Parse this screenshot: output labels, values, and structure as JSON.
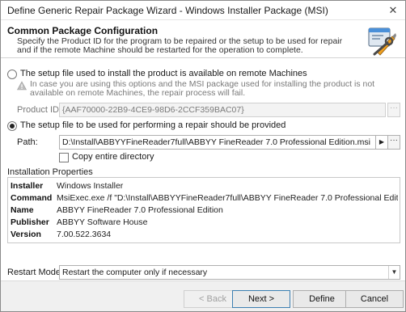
{
  "window": {
    "title": "Define Generic Repair Package Wizard - Windows Installer Package (MSI)",
    "close_icon": "close-icon"
  },
  "header": {
    "title": "Common Package Configuration",
    "description": "Specify the Product ID for the program to be repaired or the setup to be used for repair and if the remote Machine should be restarted for the operation to complete.",
    "icon": "wizard-tools-icon"
  },
  "remote_option": {
    "label": "The setup file used to install the product is available on remote Machines",
    "selected": false,
    "warning": "In case you are using this options and the MSI package used for installing the product is not available on remote Machines, the repair process will fail.",
    "product_id_label": "Product ID:",
    "product_id_value": "{AAF70000-22B9-4CE9-98D6-2CCF359BAC07}"
  },
  "local_option": {
    "label": "The setup file to be used for performing a repair should be provided",
    "selected": true,
    "path_label": "Path:",
    "path_value": "D:\\Install\\ABBYYFineReader7full\\ABBYY FineReader 7.0 Professional Edition.msi",
    "copy_label": "Copy entire directory",
    "copy_checked": false
  },
  "properties": {
    "title": "Installation Properties",
    "rows": [
      {
        "key": "Installer",
        "value": "Windows Installer"
      },
      {
        "key": "Command",
        "value": "MsiExec.exe /f \"D:\\Install\\ABBYYFineReader7full\\ABBYY FineReader 7.0 Professional Edition.msi\" /qn /..."
      },
      {
        "key": "Name",
        "value": "ABBYY FineReader 7.0 Professional Edition"
      },
      {
        "key": "Publisher",
        "value": "ABBYY Software House"
      },
      {
        "key": "Version",
        "value": "7.00.522.3634"
      }
    ]
  },
  "restart": {
    "label": "Restart Mode:",
    "value": "Restart the computer only if necessary"
  },
  "buttons": {
    "back": "< Back",
    "next": "Next >",
    "define": "Define",
    "cancel": "Cancel"
  },
  "misc": {
    "dots": "···",
    "arrow": "▶",
    "dropdown": "▼",
    "close": "✕"
  }
}
